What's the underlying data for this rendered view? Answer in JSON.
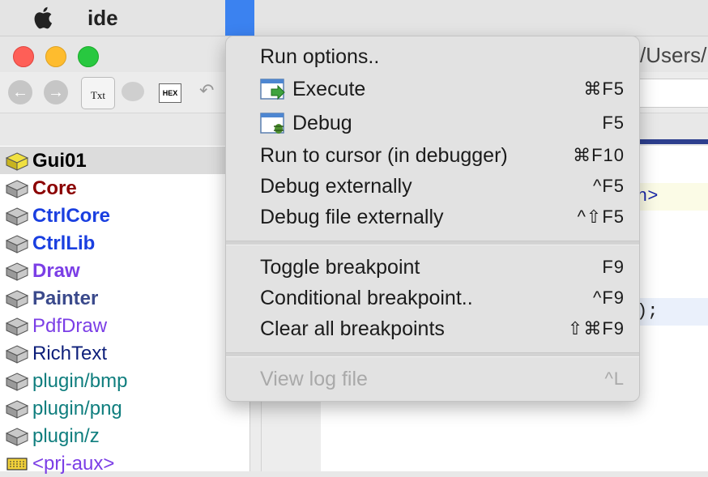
{
  "menubar": {
    "app_name": "ide"
  },
  "window": {
    "title_path": "/Users/"
  },
  "toolbar": {
    "txt_label": "Txt",
    "hex_label": "HEX"
  },
  "packages": [
    {
      "label": "Gui01",
      "color": "#000000",
      "bold": true,
      "selected": true,
      "icon": "main-package-icon"
    },
    {
      "label": "Core",
      "color": "#8b0000",
      "bold": true,
      "icon": "package-icon"
    },
    {
      "label": "CtrlCore",
      "color": "#1a3fe0",
      "bold": true,
      "icon": "package-icon"
    },
    {
      "label": "CtrlLib",
      "color": "#1a3fe0",
      "bold": true,
      "icon": "package-icon"
    },
    {
      "label": "Draw",
      "color": "#7b3ee6",
      "bold": true,
      "icon": "package-icon"
    },
    {
      "label": "Painter",
      "color": "#3b4a8c",
      "bold": true,
      "icon": "package-icon"
    },
    {
      "label": "PdfDraw",
      "color": "#7b3ee6",
      "bold": false,
      "icon": "package-icon"
    },
    {
      "label": "RichText",
      "color": "#0d1f7a",
      "bold": false,
      "icon": "package-icon"
    },
    {
      "label": "plugin/bmp",
      "color": "#0f7e7e",
      "bold": false,
      "icon": "package-icon"
    },
    {
      "label": "plugin/png",
      "color": "#0f7e7e",
      "bold": false,
      "icon": "package-icon"
    },
    {
      "label": "plugin/z",
      "color": "#0f7e7e",
      "bold": false,
      "icon": "package-icon"
    },
    {
      "label": "<prj-aux>",
      "color": "#7b3ee6",
      "bold": false,
      "icon": "aux-package-icon"
    }
  ],
  "editor": {
    "line1": "h>",
    "line2": ");"
  },
  "menu": {
    "items": [
      {
        "label": "Run options..",
        "shortcut": ""
      },
      {
        "label": "Execute",
        "shortcut": "⌘F5",
        "icon": "execute-icon"
      },
      {
        "label": "Debug",
        "shortcut": "F5",
        "icon": "debug-icon"
      },
      {
        "label": "Run to cursor (in debugger)",
        "shortcut": "⌘F10"
      },
      {
        "label": "Debug externally",
        "shortcut": "^F5"
      },
      {
        "label": "Debug file externally",
        "shortcut": "^⇧F5"
      },
      {
        "label": "Toggle breakpoint",
        "shortcut": "F9"
      },
      {
        "label": "Conditional breakpoint..",
        "shortcut": "^F9"
      },
      {
        "label": "Clear all breakpoints",
        "shortcut": "⇧⌘F9"
      },
      {
        "label": "View log file",
        "shortcut": "^L",
        "disabled": true
      }
    ]
  }
}
